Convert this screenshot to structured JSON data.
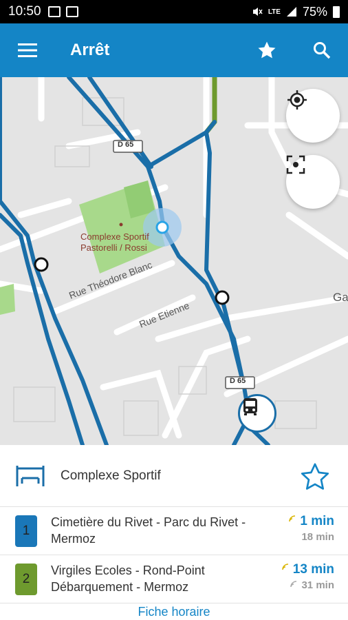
{
  "status_bar": {
    "time": "10:50",
    "battery_percent": "75%",
    "network_label": "LTE",
    "icons": [
      "gallery-icon",
      "photo-icon",
      "mute-icon",
      "lte-icon",
      "signal-icon",
      "battery-icon"
    ]
  },
  "app_bar": {
    "title": "Arrêt",
    "icons": [
      "menu-icon",
      "star-icon",
      "search-icon"
    ],
    "color": "#1485c6"
  },
  "map": {
    "labels": {
      "sports_complex_line1": "Complexe Sportif",
      "sports_complex_line2": "Pastorelli / Rossi",
      "street_1": "Rue Théodore Blanc",
      "street_2": "Rue Etienne",
      "road_ref_1": "D 65",
      "road_ref_2": "D 65",
      "partial_place": "Ga"
    },
    "buttons": [
      "locate-icon",
      "fit-view-icon"
    ],
    "route_color": "#1a6ea8"
  },
  "stop": {
    "name": "Complexe Sportif",
    "icon": "bus-stop-icon",
    "favorite_icon": "star-outline-icon"
  },
  "lines": [
    {
      "number": "1",
      "color": "#1a77b8",
      "destination": "Cimetière du Rivet - Parc du Rivet - Mermoz",
      "next": "1 min",
      "following": "18 min",
      "next_realtime": true,
      "following_realtime": false
    },
    {
      "number": "2",
      "color": "#6e9a2e",
      "destination": "Virgiles Ecoles - Rond-Point Débarquement - Mermoz",
      "next": "13 min",
      "following": "31 min",
      "next_realtime": true,
      "following_realtime": true
    }
  ],
  "footer": {
    "link_label": "Fiche horaire"
  }
}
